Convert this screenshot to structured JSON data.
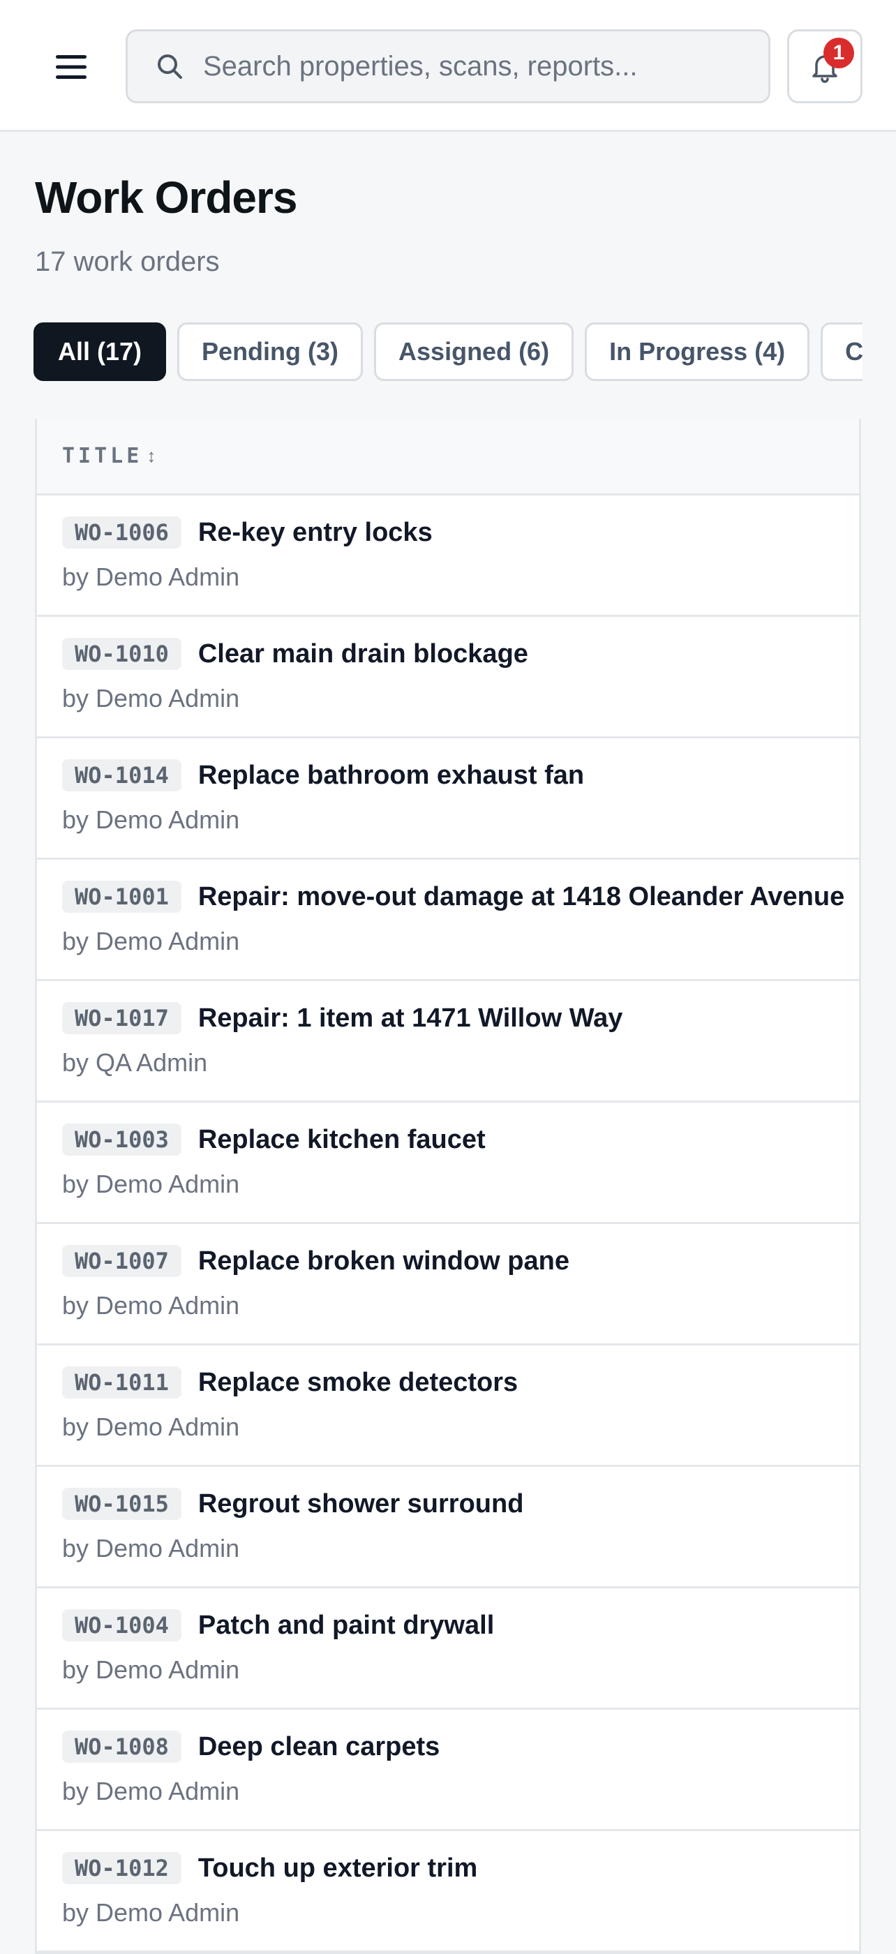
{
  "header": {
    "search_placeholder": "Search properties, scans, reports...",
    "notification_count": "1",
    "icons": {
      "menu": "hamburger-menu-icon",
      "search": "search-icon",
      "notifications": "bell-icon"
    }
  },
  "page": {
    "title": "Work Orders",
    "subtitle": "17 work orders"
  },
  "tabs": [
    {
      "label": "All (17)",
      "active": true
    },
    {
      "label": "Pending (3)",
      "active": false
    },
    {
      "label": "Assigned (6)",
      "active": false
    },
    {
      "label": "In Progress (4)",
      "active": false
    },
    {
      "label": "Co",
      "active": false
    }
  ],
  "table": {
    "column_title": "TITLE",
    "sort_glyph": "↕",
    "rows": [
      {
        "id": "WO-1006",
        "title": "Re-key entry locks",
        "by": "by Demo Admin"
      },
      {
        "id": "WO-1010",
        "title": "Clear main drain blockage",
        "by": "by Demo Admin"
      },
      {
        "id": "WO-1014",
        "title": "Replace bathroom exhaust fan",
        "by": "by Demo Admin"
      },
      {
        "id": "WO-1001",
        "title": "Repair: move-out damage at 1418 Oleander Avenue",
        "by": "by Demo Admin"
      },
      {
        "id": "WO-1017",
        "title": "Repair: 1 item at 1471 Willow Way",
        "by": "by QA Admin"
      },
      {
        "id": "WO-1003",
        "title": "Replace kitchen faucet",
        "by": "by Demo Admin"
      },
      {
        "id": "WO-1007",
        "title": "Replace broken window pane",
        "by": "by Demo Admin"
      },
      {
        "id": "WO-1011",
        "title": "Replace smoke detectors",
        "by": "by Demo Admin"
      },
      {
        "id": "WO-1015",
        "title": "Regrout shower surround",
        "by": "by Demo Admin"
      },
      {
        "id": "WO-1004",
        "title": "Patch and paint drywall",
        "by": "by Demo Admin"
      },
      {
        "id": "WO-1008",
        "title": "Deep clean carpets",
        "by": "by Demo Admin"
      },
      {
        "id": "WO-1012",
        "title": "Touch up exterior trim",
        "by": "by Demo Admin"
      }
    ]
  },
  "colors": {
    "active_tab": "#0f1720",
    "badge": "#d92c2c",
    "background": "#f5f7f8"
  }
}
